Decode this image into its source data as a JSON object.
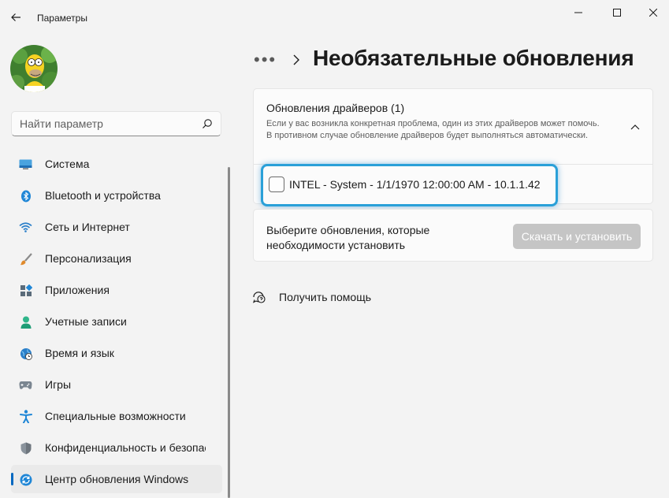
{
  "window": {
    "title": "Параметры",
    "accent": "#0067c0"
  },
  "search": {
    "placeholder": "Найти параметр"
  },
  "sidebar": {
    "items": [
      {
        "label": "Система",
        "icon": "system-icon"
      },
      {
        "label": "Bluetooth и устройства",
        "icon": "bluetooth-icon"
      },
      {
        "label": "Сеть и Интернет",
        "icon": "wifi-icon"
      },
      {
        "label": "Персонализация",
        "icon": "brush-icon"
      },
      {
        "label": "Приложения",
        "icon": "apps-icon"
      },
      {
        "label": "Учетные записи",
        "icon": "account-icon"
      },
      {
        "label": "Время и язык",
        "icon": "clock-globe-icon"
      },
      {
        "label": "Игры",
        "icon": "gamepad-icon"
      },
      {
        "label": "Специальные возможности",
        "icon": "accessibility-icon"
      },
      {
        "label": "Конфиденциальность и безопас",
        "icon": "shield-icon"
      },
      {
        "label": "Центр обновления Windows",
        "icon": "update-icon",
        "active": true
      }
    ]
  },
  "header": {
    "breadcrumb_more": "•••",
    "page_title": "Необязательные обновления"
  },
  "driver_updates": {
    "title": "Обновления драйверов (1)",
    "description": "Если у вас возникла конкретная проблема, один из этих драйверов может помочь. В противном случае обновление драйверов будет выполняться автоматически.",
    "items": [
      {
        "label": "INTEL - System - 1/1/1970 12:00:00 AM - 10.1.1.42",
        "checked": false
      }
    ]
  },
  "install": {
    "text": "Выберите обновления, которые необходимости установить",
    "button_label": "Скачать и установить"
  },
  "help": {
    "label": "Получить помощь"
  }
}
